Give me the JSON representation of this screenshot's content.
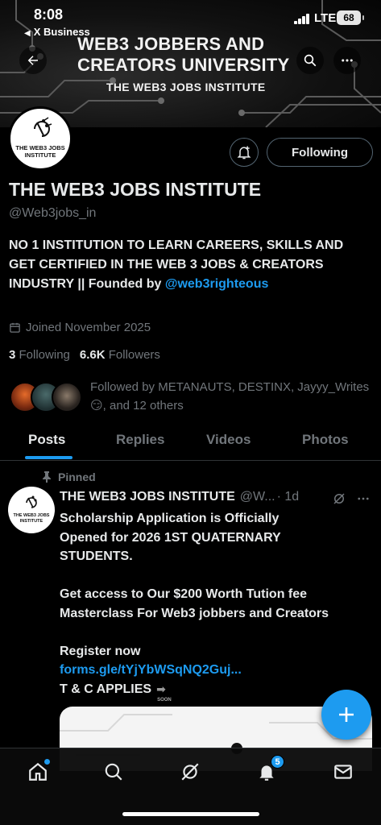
{
  "status_bar": {
    "time": "8:08",
    "back_app": "X Business",
    "network": "LTE",
    "battery": "68"
  },
  "banner": {
    "title": "WEB3 JOBBERS AND CREATORS UNIVERSITY",
    "subtitle": "THE WEB3 JOBS INSTITUTE"
  },
  "profile": {
    "avatar_text": "THE WEB3 JOBS INSTITUTE",
    "name": "THE WEB3 JOBS INSTITUTE",
    "handle": "@Web3jobs_in",
    "bio_text": "NO 1 INSTITUTION TO LEARN CAREERS, SKILLS AND GET CERTIFIED IN THE WEB 3 JOBS & CREATORS INDUSTRY || Founded by",
    "bio_mention": "@web3righteous",
    "joined": "Joined November 2025",
    "following_count": "3",
    "following_label": "Following",
    "followers_count": "6.6K",
    "followers_label": "Followers",
    "followed_by": "Followed by METANAUTS, DESTINX, Jayyy_Writes",
    "followed_by_emoji": "😏",
    "followed_by_suffix": ", and 12 others",
    "following_button": "Following"
  },
  "tabs": [
    "Posts",
    "Replies",
    "Videos",
    "Photos"
  ],
  "post": {
    "pinned_label": "Pinned",
    "author": "THE WEB3 JOBS INSTITUTE",
    "handle": "@W...",
    "time": "· 1d",
    "lines": [
      "Scholarship Application is Officially",
      "Opened for 2026 1ST QUATERNARY",
      "STUDENTS."
    ],
    "lines2": [
      "Get access to Our $200 Worth Tution fee",
      "Masterclass For Web3 jobbers and Creators"
    ],
    "register": "Register now",
    "link": "forms.gle/tYjYbWSqNQ2Guj...",
    "tc": "T & C APPLIES",
    "soon_label": "SOON"
  },
  "bottom_nav": {
    "notifications_badge": "5"
  },
  "colors": {
    "accent": "#1d9bf0",
    "background": "#000000",
    "muted": "#71767b",
    "text": "#e7e9ea"
  }
}
